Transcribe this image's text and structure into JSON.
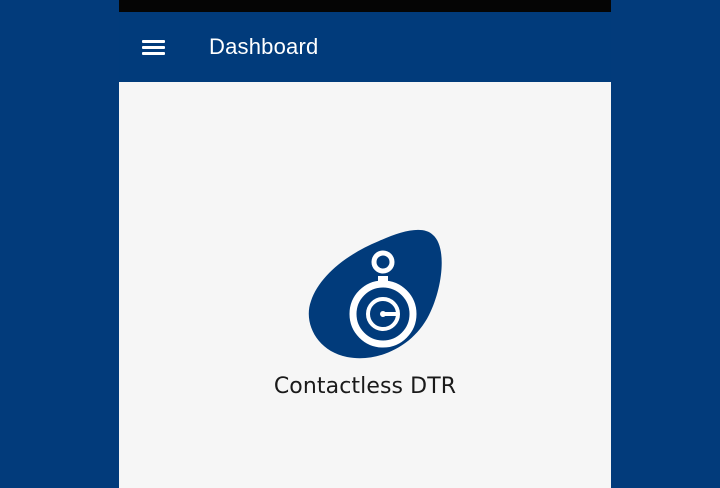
{
  "app_bar": {
    "title": "Dashboard",
    "menu_icon": "hamburger-menu-icon",
    "background_color": "#013b7b"
  },
  "logo": {
    "icon": "contactless-dtr-logo",
    "label": "Contactless DTR",
    "color": "#013b7b"
  },
  "colors": {
    "page_background": "#023b7b",
    "content_background": "#f6f6f6",
    "status_bar": "#050505"
  }
}
